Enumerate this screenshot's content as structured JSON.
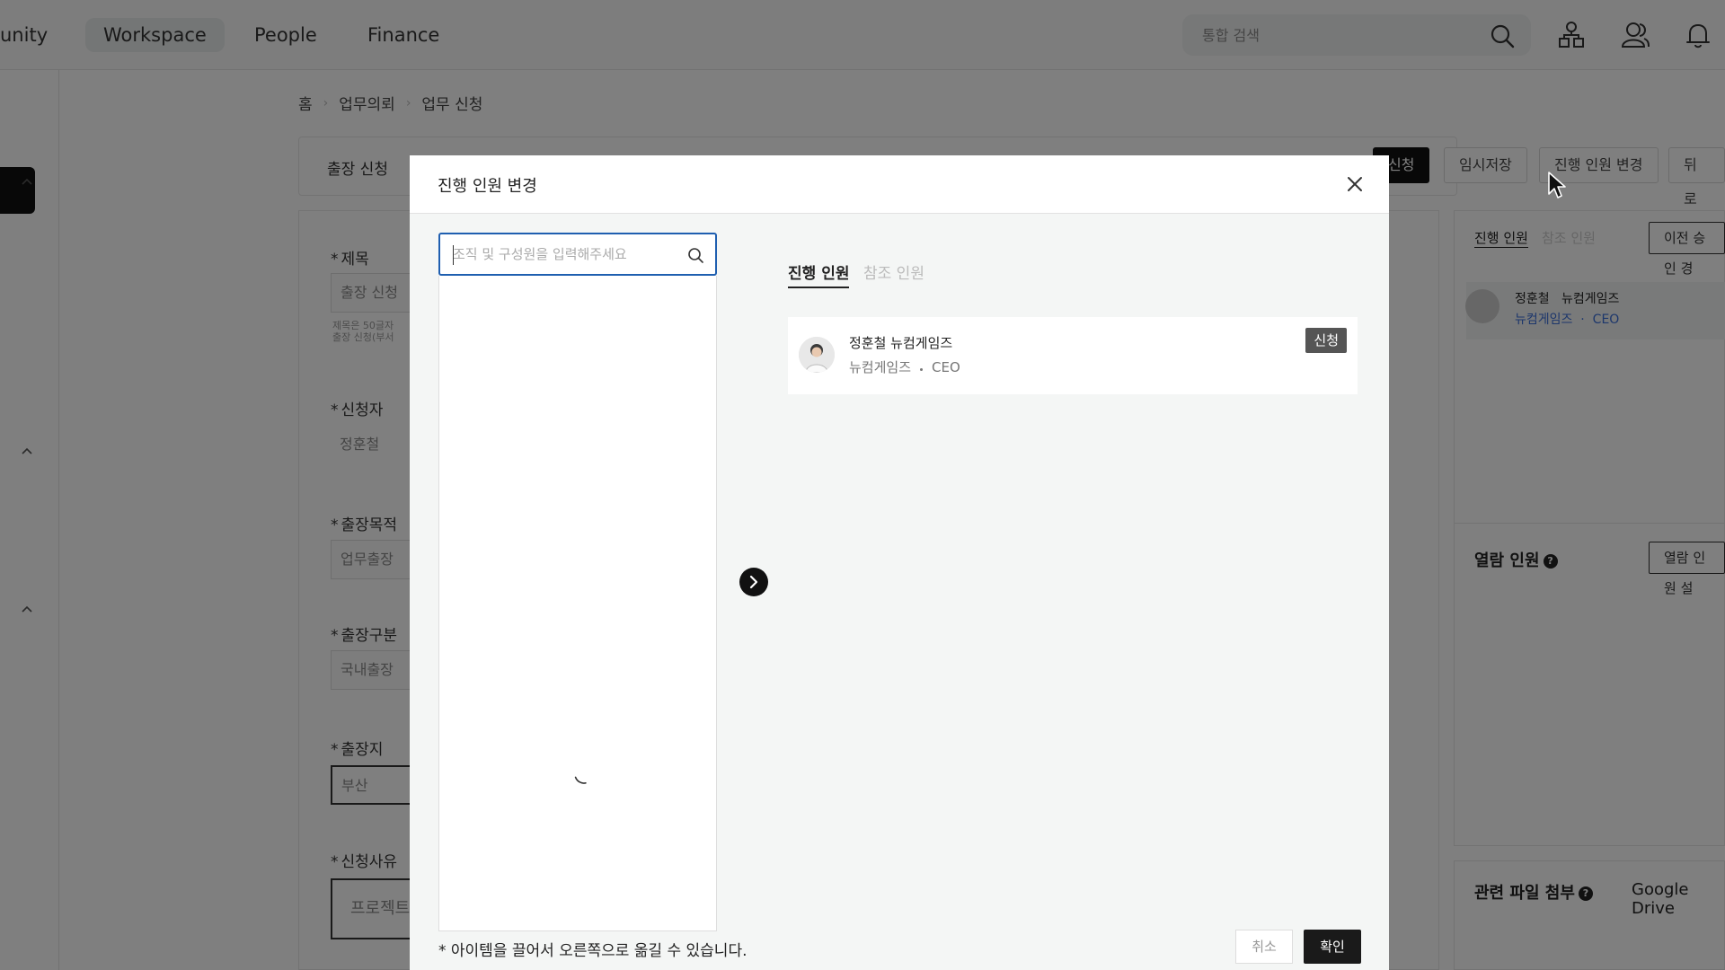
{
  "topnav": {
    "items": [
      "unity",
      "Workspace",
      "People",
      "Finance"
    ],
    "active_index": 1,
    "search_placeholder": "통합 검색",
    "icons": [
      "search-icon",
      "org-chart-icon",
      "people-icon",
      "bell-icon"
    ]
  },
  "breadcrumb": [
    "홈",
    "업무의뢰",
    "업무 신청"
  ],
  "form_header": {
    "title": "출장 신청",
    "buttons": [
      "신청",
      "임시저장",
      "진행 인원 변경",
      "뒤로가"
    ]
  },
  "form": {
    "title_label": "제목",
    "title_value": "출장 신청",
    "title_hints": [
      "제목은 50글자",
      "출장 신청(부서"
    ],
    "applicant_label": "신청자",
    "applicant_value": "정훈철",
    "purpose_label": "출장목적",
    "purpose_value": "업무출장",
    "type_label": "출장구분",
    "type_value": "국내출장",
    "place_label": "출장지",
    "place_value": "부산",
    "reason_label": "신청사유",
    "reason_value": "프로젝트"
  },
  "right_panel": {
    "tabs": [
      "진행 인원",
      "참조 인원"
    ],
    "prev_button": "이전 승인 경",
    "person_name": "정훈철",
    "person_company": "뉴컴게임즈",
    "person_team": "뉴컴게임즈",
    "person_role": "CEO",
    "viewers_title": "열람 인원",
    "viewers_button": "열람 인원 설",
    "files_title": "관련 파일 첨부",
    "files_source": "Google Drive"
  },
  "modal": {
    "title": "진행 인원 변경",
    "search_placeholder": "조직 및 구성원을 입력해주세요",
    "tabs": [
      "진행 인원",
      "참조 인원"
    ],
    "selected": [
      {
        "name": "정훈철 뉴컴게임즈",
        "company": "뉴컴게임즈",
        "role": "CEO",
        "badge": "신청"
      }
    ],
    "footer_note": "* 아이템을 끌어서 오른쪽으로 옮길 수 있습니다.",
    "cancel_label": "취소",
    "confirm_label": "확인"
  },
  "colors": {
    "focus_border": "#1f5fb0",
    "overlay": "rgba(0,0,0,0.5)",
    "badge_bg": "#555555",
    "link_blue": "#3a6fd8"
  }
}
